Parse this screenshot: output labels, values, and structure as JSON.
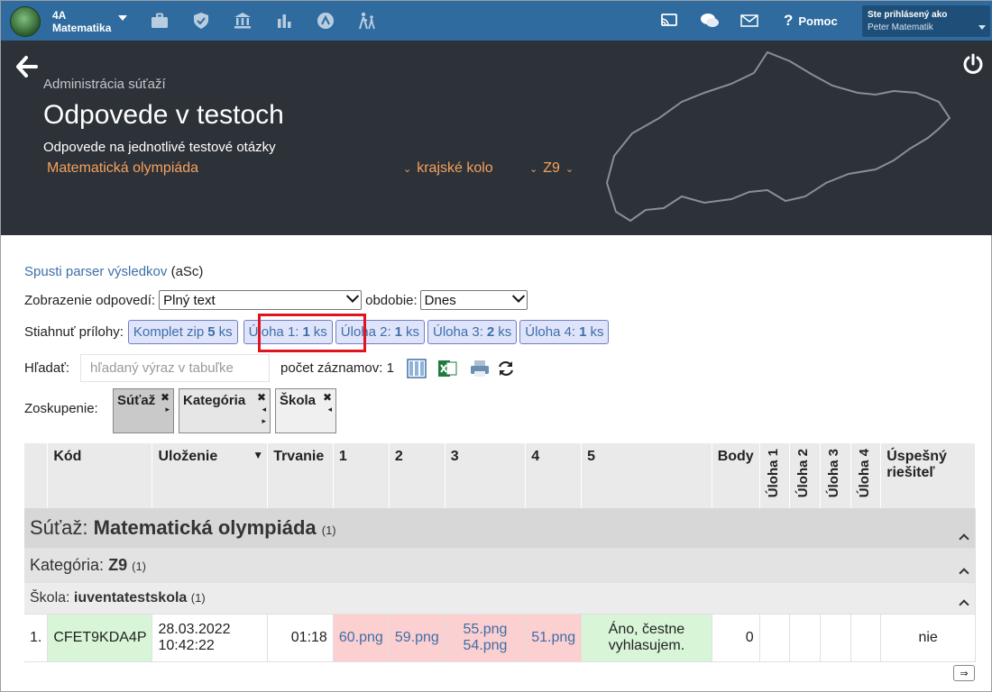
{
  "topbar": {
    "class_name": "4A",
    "class_subject": "Matematika",
    "help_label": "Pomoc",
    "user_line1": "Ste prihlásený ako",
    "user_line2": "Peter Matematik"
  },
  "header": {
    "breadcrumb": "Administrácia súťaží",
    "title": "Odpovede v testoch",
    "subtitle": "Odpovede na jednotlivé testové otázky",
    "filter_competition": "Matematická olympiáda",
    "filter_round": "krajské kolo",
    "filter_category": "Z9"
  },
  "toolbar": {
    "parser_link": "Spusti parser výsledkov",
    "parser_suffix": "(aSc)",
    "display_label": "Zobrazenie odpovedí:",
    "display_value": "Plný text",
    "period_label": "obdobie:",
    "period_value": "Dnes",
    "download_label": "Stiahnuť prílohy:",
    "downloads": [
      {
        "label": "Komplet zip",
        "count": "5",
        "unit": "ks"
      },
      {
        "label": "Úloha 1:",
        "count": "1",
        "unit": "ks"
      },
      {
        "label": "Úloha 2:",
        "count": "1",
        "unit": "ks"
      },
      {
        "label": "Úloha 3:",
        "count": "2",
        "unit": "ks"
      },
      {
        "label": "Úloha 4:",
        "count": "1",
        "unit": "ks"
      }
    ],
    "search_label": "Hľadať:",
    "search_placeholder": "hľadaný výraz v tabuľke",
    "record_count": "počet záznamov: 1",
    "grouping_label": "Zoskupenie:",
    "groups": [
      "Súťaž",
      "Kategória",
      "Škola"
    ]
  },
  "table": {
    "headers": [
      "Kód",
      "Uloženie",
      "Trvanie",
      "1",
      "2",
      "3",
      "4",
      "5",
      "Body",
      "Úloha 1",
      "Úloha 2",
      "Úloha 3",
      "Úloha 4",
      "Úspešný riešiteľ"
    ],
    "group1_label": "Súťaž:",
    "group1_value": "Matematická olympiáda",
    "group1_count": "(1)",
    "group2_label": "Kategória:",
    "group2_value": "Z9",
    "group2_count": "(1)",
    "group3_label": "Škola:",
    "group3_value": "iuventatestskola",
    "group3_count": "(1)",
    "row": {
      "index": "1.",
      "code": "CFET9KDA4P",
      "date": "28.03.2022",
      "time": "10:42:22",
      "duration": "01:18",
      "a1": "60.png",
      "a2": "59.png",
      "a3_1": "55.png",
      "a3_2": "54.png",
      "a4": "51.png",
      "a5_1": "Áno, čestne",
      "a5_2": "vyhlasujem.",
      "points": "0",
      "success": "nie"
    },
    "pager_next": "⇒"
  },
  "colors": {
    "topbar": "#2f6b9e",
    "header": "#2d3138",
    "accent_orange": "#f5a25f",
    "highlight": "#e0141e",
    "link": "#3d6fa8"
  }
}
